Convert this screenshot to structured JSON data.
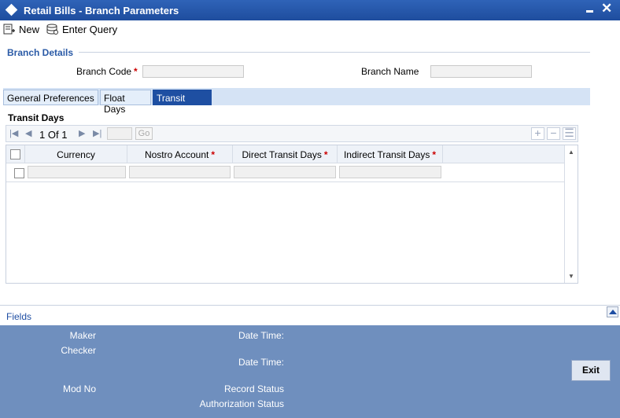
{
  "window": {
    "title": "Retail Bills - Branch Parameters"
  },
  "toolbar": {
    "new_label": "New",
    "enter_query_label": "Enter Query"
  },
  "branch_details": {
    "section_title": "Branch Details",
    "branch_code_label": "Branch Code",
    "branch_code_value": "",
    "branch_name_label": "Branch Name",
    "branch_name_value": "",
    "required_mark": "*"
  },
  "tabs": [
    {
      "label": "General Preferences",
      "active": false
    },
    {
      "label": "Float Days",
      "active": false
    },
    {
      "label": "Transit Days",
      "active": true
    }
  ],
  "transit_days": {
    "title": "Transit Days",
    "pager": {
      "current": "1",
      "of_label": "Of",
      "total": "1",
      "go_label": "Go"
    },
    "columns": [
      {
        "label": "Currency",
        "required": false
      },
      {
        "label": "Nostro Account",
        "required": true
      },
      {
        "label": "Direct Transit Days",
        "required": true
      },
      {
        "label": "Indirect Transit Days",
        "required": true
      }
    ],
    "rows": [
      {
        "currency": "",
        "nostro_account": "",
        "direct_transit_days": "",
        "indirect_transit_days": ""
      }
    ]
  },
  "fields_label": "Fields",
  "audit": {
    "maker_label": "Maker",
    "checker_label": "Checker",
    "date_time_label": "Date Time:",
    "mod_no_label": "Mod No",
    "record_status_label": "Record Status",
    "authorization_status_label": "Authorization Status"
  },
  "exit_label": "Exit",
  "colors": {
    "title_bar": "#2f63b8",
    "active_tab": "#1e4fa2",
    "footer": "#6f8fbe",
    "section_title": "#2a5aa6",
    "required": "#cc0000"
  }
}
